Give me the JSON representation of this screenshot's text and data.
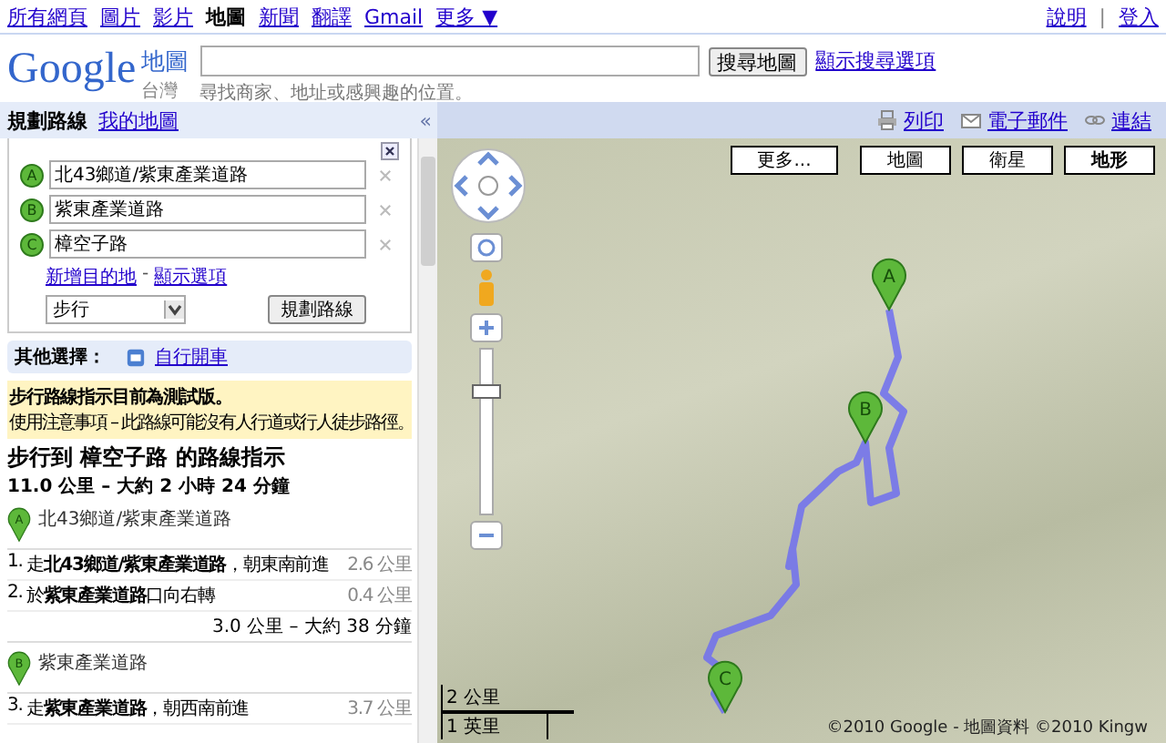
{
  "top_nav": {
    "links": [
      {
        "label": "所有網頁",
        "selected": false
      },
      {
        "label": "圖片",
        "selected": false
      },
      {
        "label": "影片",
        "selected": false
      },
      {
        "label": "地圖",
        "selected": true
      },
      {
        "label": "新聞",
        "selected": false
      },
      {
        "label": "翻譯",
        "selected": false
      },
      {
        "label": "Gmail",
        "selected": false
      }
    ],
    "more": {
      "label": "更多",
      "arrow": "▼"
    },
    "help": "說明",
    "separator": "|",
    "sign_in": "登入"
  },
  "header": {
    "logo": "Google",
    "product": "地圖",
    "region": "台灣",
    "hint": "尋找商家、地址或感興趣的位置。",
    "search_button": "搜尋地圖",
    "options_link": "顯示搜尋選項"
  },
  "panel_tabs": [
    {
      "label": "規劃路線",
      "selected": true
    },
    {
      "label": "我的地圖",
      "selected": false
    }
  ],
  "collapse": "«",
  "map_actions": [
    {
      "kind": "print",
      "label": "列印"
    },
    {
      "kind": "email",
      "label": "電子郵件"
    },
    {
      "kind": "link",
      "label": "連結"
    }
  ],
  "directions_form": {
    "waypoints": [
      {
        "marker": "A",
        "value": "北43鄉道/紫東產業道路"
      },
      {
        "marker": "B",
        "value": "紫東產業道路"
      },
      {
        "marker": "C",
        "value": "樟空子路"
      }
    ],
    "add_link": "新增目的地",
    "separator": "-",
    "options_link": "顯示選項",
    "mode": "步行",
    "submit": "規劃路線"
  },
  "alternatives": {
    "label": "其他選擇：",
    "link": "自行開車"
  },
  "notice": {
    "title": "步行路線指示目前為測試版。",
    "text": "使用注意事項 – 此路線可能沒有人行道或行人徒步路徑。"
  },
  "route": {
    "title": "步行到 樟空子路 的路線指示",
    "summary": "11.0 公里 – 大約 2 小時 24 分鐘"
  },
  "legs": [
    {
      "marker": "A",
      "place": "北43鄉道/紫東產業道路",
      "steps": [
        {
          "number": "1.",
          "text": "走**北43鄉道/紫東產業道路**，朝東南前進",
          "distance": "2.6 公里"
        },
        {
          "number": "2.",
          "text": "於**紫東產業道路**口向右轉",
          "distance": "0.4 公里"
        }
      ],
      "summary": "3.0 公里 – 大約 38 分鐘"
    },
    {
      "marker": "B",
      "place": "紫東產業道路",
      "steps": [
        {
          "number": "3.",
          "text": "走**紫東產業道路**，朝西南前進",
          "distance": "3.7 公里"
        }
      ]
    }
  ],
  "map": {
    "types": [
      {
        "label": "更多...",
        "selected": false
      },
      {
        "label": "地圖",
        "selected": false
      },
      {
        "label": "衛星",
        "selected": false
      },
      {
        "label": "地形",
        "selected": true
      }
    ],
    "zoom": {
      "level": 0.74
    },
    "markers": [
      "A",
      "B",
      "C"
    ],
    "scale": {
      "metric": "2 公里",
      "imperial": "1 英里"
    },
    "copyright": "©2010 Google - 地圖資料 ©2010 Kingw"
  }
}
